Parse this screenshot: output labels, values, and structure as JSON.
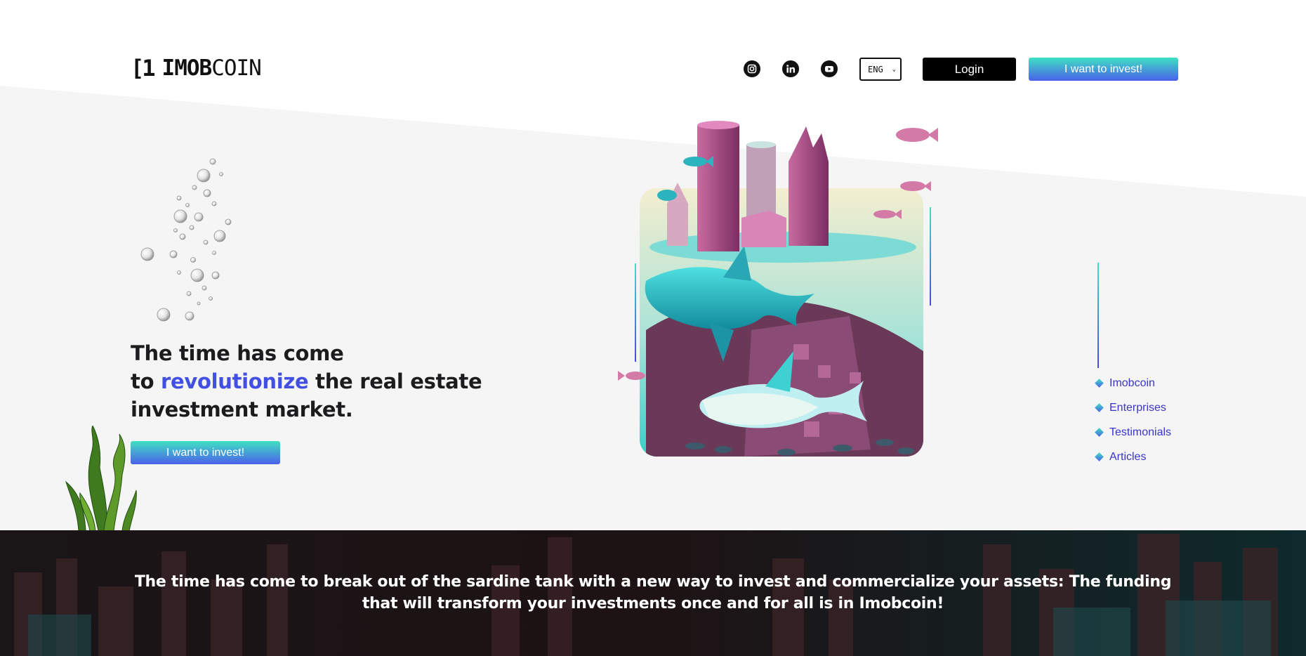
{
  "brand": {
    "logo_mark": "[1",
    "logo_bold": "IMOB",
    "logo_light": "COIN",
    "accent_color": "#4150e3"
  },
  "header": {
    "social": [
      "instagram-icon",
      "linkedin-icon",
      "youtube-icon"
    ],
    "language": "ENG",
    "login_label": "Login",
    "invest_label": "I want to invest!"
  },
  "hero": {
    "headline_line1": "The time has come",
    "headline_to": "to",
    "headline_accent": "revolutionize",
    "headline_line2_rest": "the real estate",
    "headline_line3": "investment market.",
    "cta_label": "I want to invest!"
  },
  "side_nav": {
    "items": [
      {
        "label": "Imobcoin"
      },
      {
        "label": "Enterprises"
      },
      {
        "label": "Testimonials"
      },
      {
        "label": "Articles"
      }
    ]
  },
  "banner": {
    "text": "The time has come to break out of the sardine tank with a new way to invest and commercialize your assets: The funding that will transform your investments once and for all is in Imobcoin!"
  }
}
